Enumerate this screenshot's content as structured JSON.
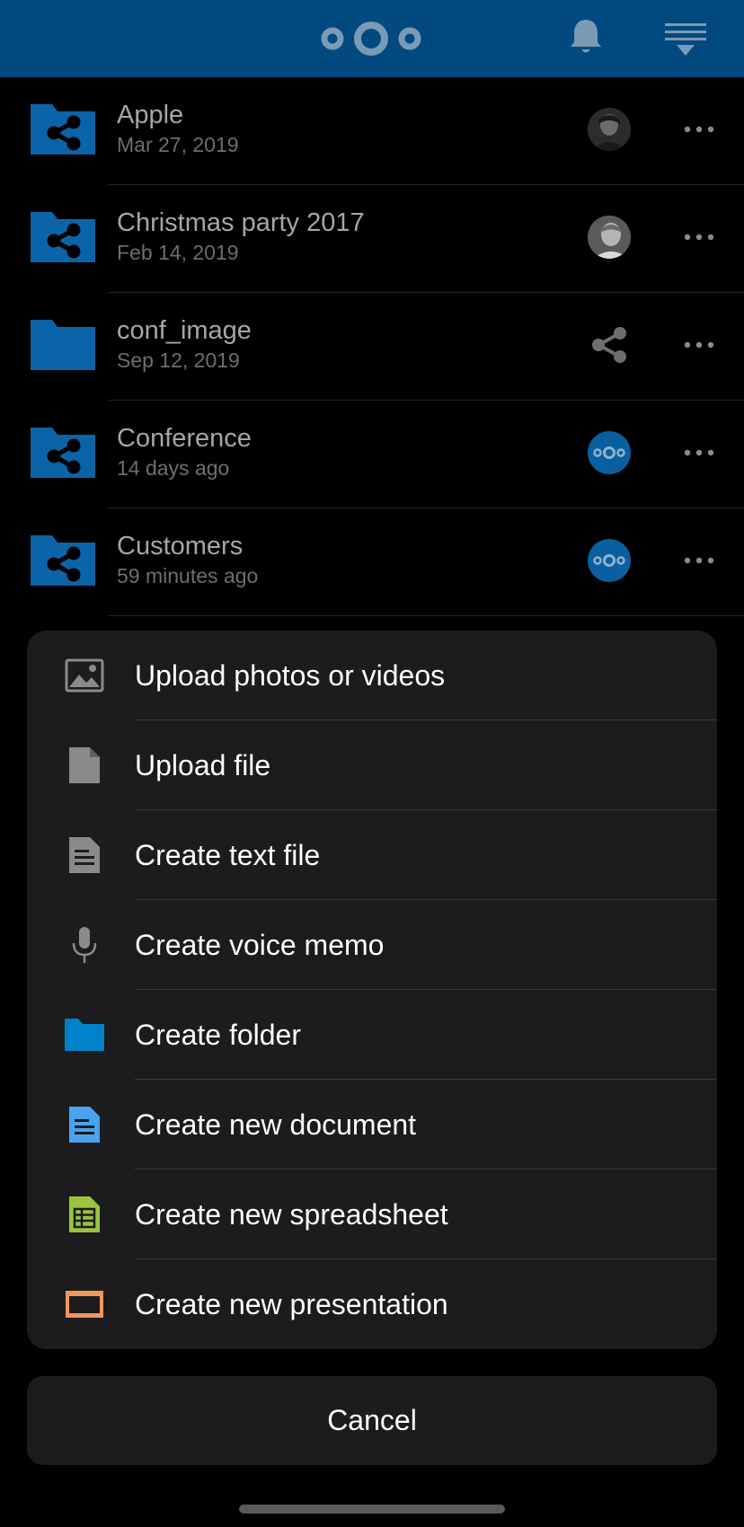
{
  "header": {
    "logo_icon": "nextcloud-logo",
    "notifications_icon": "bell-icon",
    "sort_icon": "sort-menu-icon",
    "bg_color": "#004a80"
  },
  "files": [
    {
      "name": "Apple",
      "date": "Mar 27, 2019",
      "icon": "shared-folder-icon",
      "share": "avatar-person-1"
    },
    {
      "name": "Christmas party 2017",
      "date": "Feb 14, 2019",
      "icon": "shared-folder-icon",
      "share": "avatar-person-2"
    },
    {
      "name": "conf_image",
      "date": "Sep 12, 2019",
      "icon": "folder-icon",
      "share": "share-icon"
    },
    {
      "name": "Conference",
      "date": "14 days ago",
      "icon": "shared-folder-icon",
      "share": "nextcloud-avatar"
    },
    {
      "name": "Customers",
      "date": "59 minutes ago",
      "icon": "shared-folder-icon",
      "share": "nextcloud-avatar"
    }
  ],
  "action_sheet": {
    "items": [
      {
        "label": "Upload photos or videos",
        "icon": "image-icon"
      },
      {
        "label": "Upload file",
        "icon": "file-icon"
      },
      {
        "label": "Create text file",
        "icon": "text-file-icon"
      },
      {
        "label": "Create voice memo",
        "icon": "microphone-icon"
      },
      {
        "label": "Create folder",
        "icon": "folder-icon"
      },
      {
        "label": "Create new document",
        "icon": "document-icon"
      },
      {
        "label": "Create new spreadsheet",
        "icon": "spreadsheet-icon"
      },
      {
        "label": "Create new presentation",
        "icon": "presentation-icon"
      }
    ],
    "cancel_label": "Cancel"
  },
  "colors": {
    "accent_blue": "#0082c9",
    "folder_blue": "#0b64a8",
    "document_blue": "#4aa3f0",
    "spreadsheet_green": "#9bc33e",
    "presentation_orange": "#f0975a"
  }
}
